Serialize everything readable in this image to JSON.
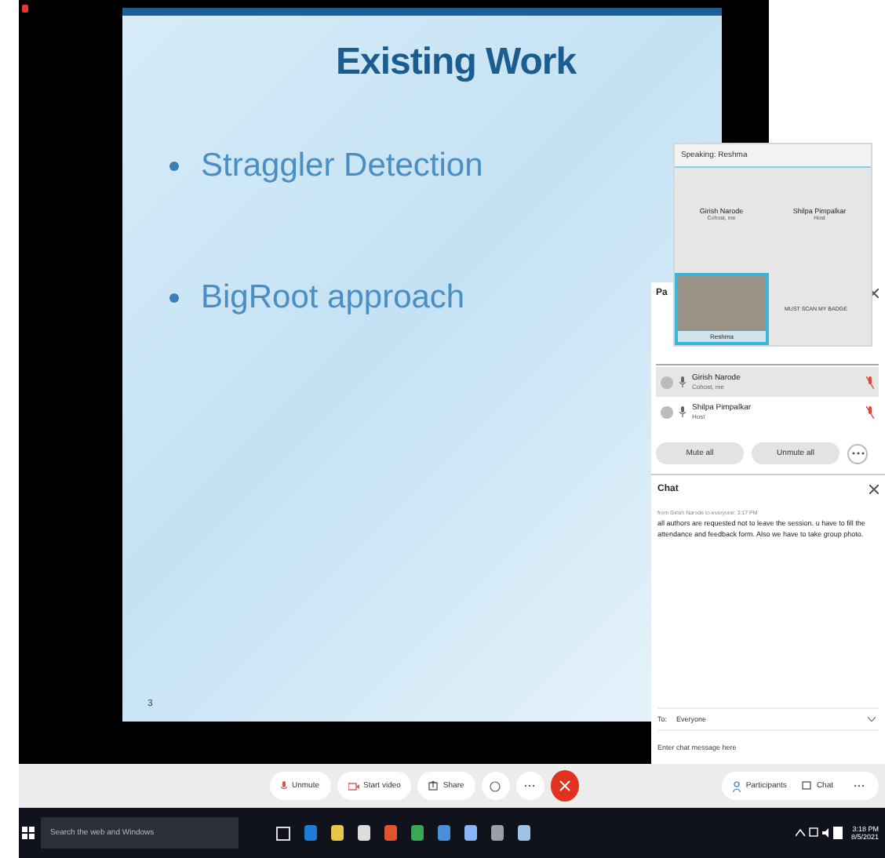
{
  "slide": {
    "title": "Existing Work",
    "bullets": [
      "Straggler Detection",
      "BigRoot approach"
    ],
    "page": "3"
  },
  "video_window": {
    "title": "Speaking: Reshma",
    "speakers": [
      {
        "name": "Girish Narode",
        "role": "Cohost, me"
      },
      {
        "name": "Shilpa Pimpalkar",
        "role": "Host"
      }
    ],
    "self_view_name": "Reshma",
    "banner": "MUST SCAN MY BADGE"
  },
  "participants_panel": {
    "header": "Pa",
    "rows": [
      {
        "name": "Girish Narode",
        "role": "Cohost, me",
        "selected": true,
        "muted": true
      },
      {
        "name": "Shilpa Pimpalkar",
        "role": "Host",
        "selected": false,
        "muted": true
      }
    ],
    "buttons": [
      "Mute all",
      "Unmute all"
    ]
  },
  "chat": {
    "title": "Chat",
    "meta": "from Girish Narode to everyone: 3:17 PM",
    "message": "all authors are requested not to leave the session. u have to fill the attendance and feedback form. Also we have to take group photo.",
    "to_label": "To:",
    "recipient": "Everyone",
    "placeholder": "Enter chat message here"
  },
  "toolbar": {
    "left": [
      {
        "kind": "mic",
        "label": "Unmute"
      },
      {
        "kind": "video",
        "label": "Start video"
      },
      {
        "kind": "share",
        "label": "Share"
      }
    ],
    "right": [
      {
        "kind": "people",
        "label": "Participants"
      },
      {
        "kind": "chat",
        "label": "Chat"
      }
    ]
  },
  "taskbar": {
    "search_placeholder": "Search the web and Windows",
    "time": "3:18 PM",
    "date": "8/5/2021"
  }
}
